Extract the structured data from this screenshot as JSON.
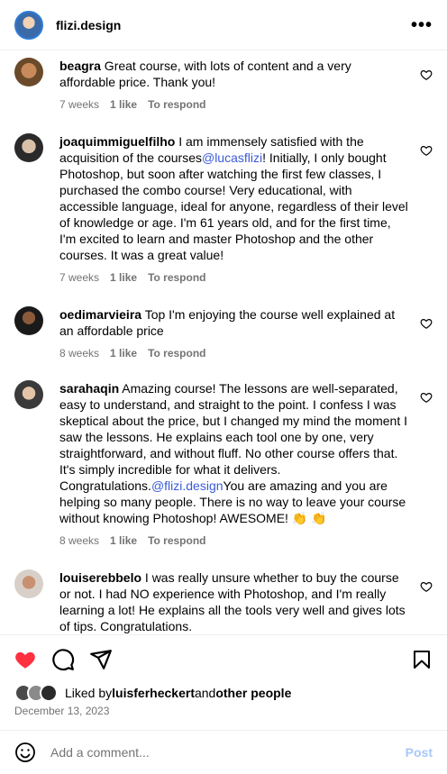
{
  "header": {
    "username": "flizi.design",
    "more_icon": "more-horizontal-icon"
  },
  "comments": [
    {
      "user": "beagra",
      "parts": [
        {
          "text": " Great course, with lots of content and a very affordable price. Thank you!"
        }
      ],
      "time": "7 weeks",
      "likes": "1 like",
      "reply": "To respond"
    },
    {
      "user": "joaquimmiguelfilho",
      "parts": [
        {
          "text": " I am immensely satisfied with the acquisition of the courses"
        },
        {
          "mention": "@lucasflizi"
        },
        {
          "text": "! Initially, I only bought Photoshop, but soon after watching the first few classes, I purchased the combo course! Very educational, with accessible language, ideal for anyone, regardless of their level of knowledge or age. I'm 61 years old, and for the first time, I'm excited to learn and master Photoshop and the other courses. It was a great value!"
        }
      ],
      "time": "7 weeks",
      "likes": "1 like",
      "reply": "To respond"
    },
    {
      "user": "oedimarvieira",
      "parts": [
        {
          "text": " Top I'm enjoying the course well explained at an affordable price"
        }
      ],
      "time": "8 weeks",
      "likes": "1 like",
      "reply": "To respond"
    },
    {
      "user": "sarahaqin",
      "parts": [
        {
          "text": " Amazing course! The lessons are well-separated, easy to understand, and straight to the point. I confess I was skeptical about the price, but I changed my mind the moment I saw the lessons. He explains each tool one by one, very straightforward, and without fluff. No other course offers that. It's simply incredible for what it delivers. Congratulations."
        },
        {
          "mention": "@flizi.design"
        },
        {
          "text": "You are amazing and you are helping so many people. There is no way to leave your course without knowing Photoshop! AWESOME! 👏 👏"
        }
      ],
      "time": "8 weeks",
      "likes": "1 like",
      "reply": "To respond"
    },
    {
      "user": "louiserebbelo",
      "parts": [
        {
          "text": " I was really unsure whether to buy the course or not. I had NO experience with Photoshop, and I'm really learning a lot! He explains all the tools very well and gives lots of tips. Congratulations."
        }
      ],
      "time": "",
      "likes": "",
      "reply": ""
    }
  ],
  "likes_line": {
    "prefix": "Liked by ",
    "user": "luisferheckert",
    "middle": "and ",
    "suffix": "other people"
  },
  "date": "December 13, 2023",
  "add_comment": {
    "placeholder": "Add a comment...",
    "post_label": "Post"
  },
  "colors": {
    "accent": "#3a5bd6",
    "like_red": "#ff3040",
    "post_disabled": "#a8c7fa",
    "meta_gray": "#737373"
  }
}
